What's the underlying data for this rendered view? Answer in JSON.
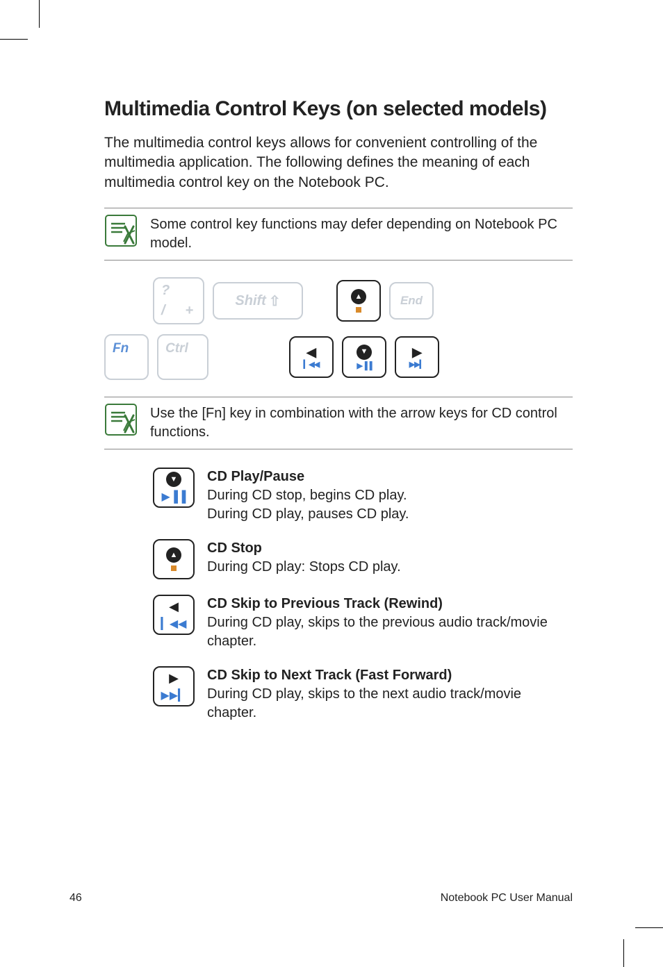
{
  "heading": "Multimedia Control Keys (on selected models)",
  "intro": "The multimedia control keys allows for convenient controlling of the multimedia application. The following defines the meaning of each multimedia control key on the Notebook PC.",
  "note1": "Some control key functions may defer depending on Notebook PC model.",
  "note2": "Use the [Fn] key in combination with the arrow keys for CD control functions.",
  "keys": {
    "shift": "Shift",
    "end": "End",
    "fn": "Fn",
    "ctrl": "Ctrl",
    "slash_q": "?",
    "slash_sl": "/",
    "slash_pl": "+"
  },
  "functions": [
    {
      "title": "CD Play/Pause",
      "body": "During CD stop, begins CD play.\nDuring CD play, pauses CD play."
    },
    {
      "title": "CD Stop",
      "body": "During CD play: Stops CD play."
    },
    {
      "title": "CD Skip to Previous Track (Rewind)",
      "body": "During CD play, skips to the previous audio track/movie chapter."
    },
    {
      "title": "CD Skip to Next Track (Fast Forward)",
      "body": "During CD play, skips to the next audio track/movie chapter."
    }
  ],
  "footer": {
    "page": "46",
    "label": "Notebook PC User Manual"
  }
}
